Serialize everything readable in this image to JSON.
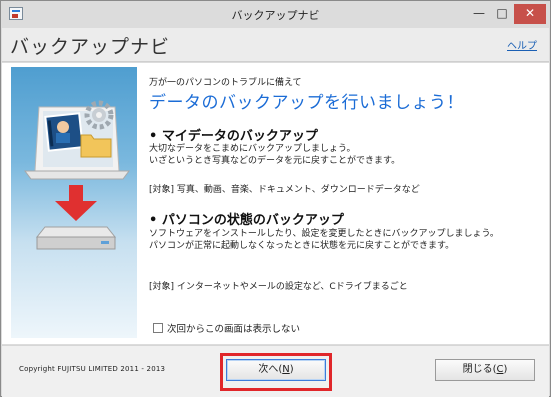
{
  "window": {
    "title": "バックアップナビ",
    "minimize_glyph": "—",
    "maximize_glyph": "□",
    "close_glyph": "✕"
  },
  "header": {
    "title": "バックアップナビ",
    "help_link": "ヘルプ"
  },
  "main": {
    "intro": "万が一のパソコンのトラブルに備えて",
    "headline": "データのバックアップを行いましょう！",
    "sections": [
      {
        "title": "• マイデータのバックアップ",
        "body_lines": [
          "大切なデータをこまめにバックアップしましょう。",
          "いざというとき写真などのデータを元に戻すことができます。"
        ],
        "target": "[対象] 写真、動画、音楽、ドキュメント、ダウンロードデータなど"
      },
      {
        "title": "• パソコンの状態のバックアップ",
        "body_lines": [
          "ソフトウェアをインストールしたり、設定を変更したときにバックアップしましょう。",
          "パソコンが正常に起動しなくなったときに状態を元に戻すことができます。"
        ],
        "target": "[対象] インターネットやメールの設定など、Cドライブまるごと"
      }
    ],
    "checkbox_label": "次回からこの画面は表示しない",
    "checkbox_checked": false
  },
  "footer": {
    "copyright": "Copyright FUJITSU LIMITED 2011 - 2013",
    "next_label": "次へ(",
    "next_key": "N",
    "close_label": "閉じる(",
    "close_key": "C",
    "paren_close": ")"
  },
  "colors": {
    "headline_blue": "#1b6cd6",
    "highlight_red": "#e0262a",
    "close_button_red": "#c7504a",
    "arrow_red": "#e03030"
  },
  "icons": [
    "app-icon",
    "laptop-icon",
    "gear-icon",
    "photo-icon",
    "folder-icon",
    "down-arrow-icon",
    "drive-icon"
  ]
}
